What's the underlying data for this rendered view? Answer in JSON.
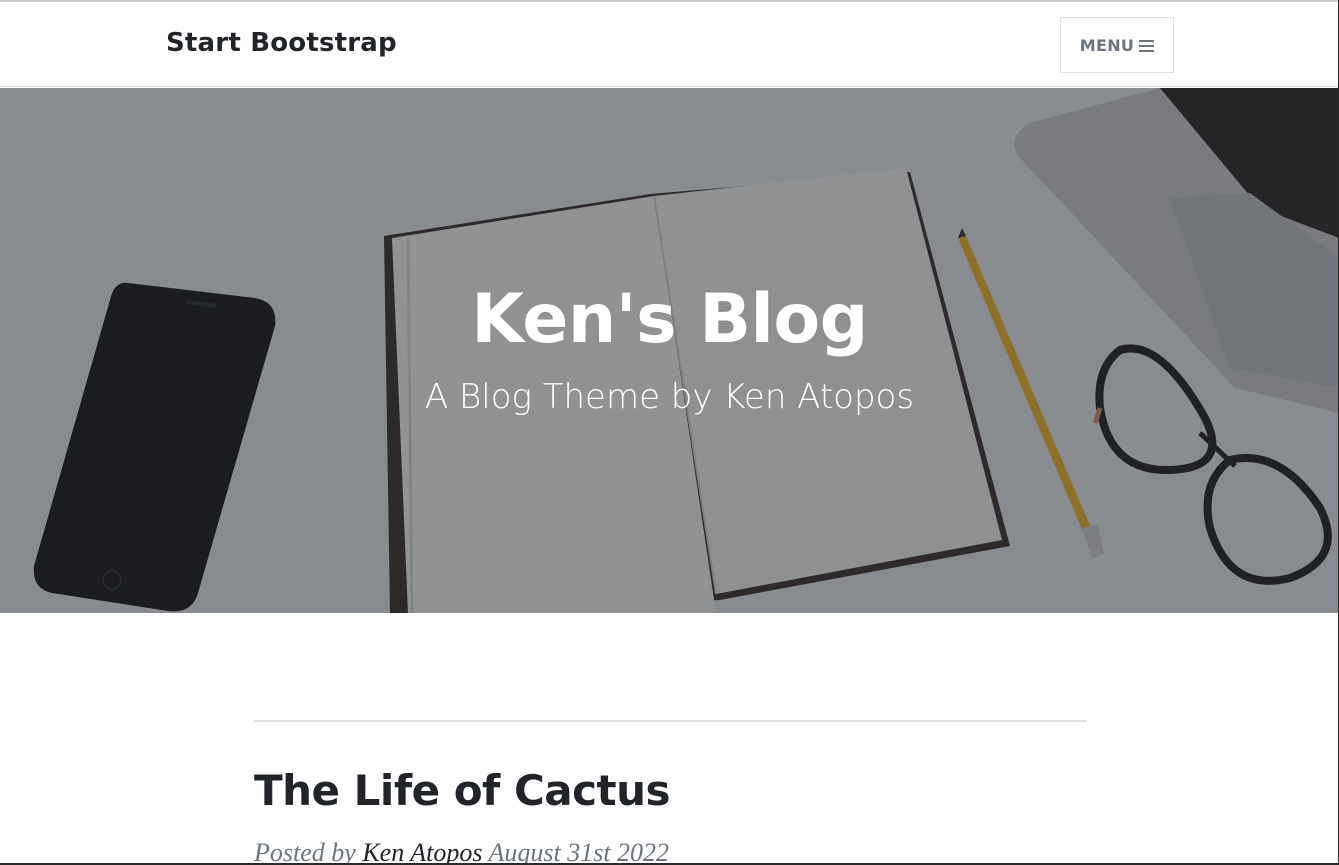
{
  "navbar": {
    "brand": "Start Bootstrap",
    "menu_label": "MENU",
    "menu_icon": "hamburger-icon"
  },
  "masthead": {
    "title": "Ken's Blog",
    "subtitle": "A Blog Theme by Ken Atopos",
    "overlay_color": "#212529"
  },
  "posts": [
    {
      "title": "The Life of Cactus",
      "meta_prefix": "Posted by",
      "author": "Ken Atopos",
      "date": "August 31st 2022"
    }
  ],
  "colors": {
    "text_dark": "#212529",
    "text_muted": "#6c757d",
    "border": "#dee2e6"
  }
}
